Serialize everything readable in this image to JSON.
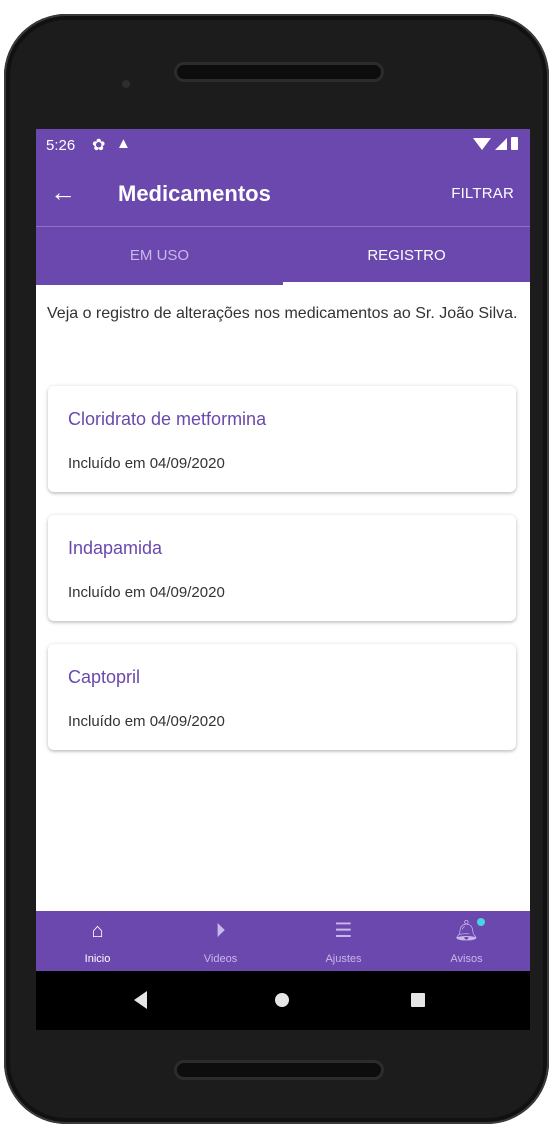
{
  "status_bar": {
    "time": "5:26"
  },
  "app_bar": {
    "back_icon": "arrow-left-icon",
    "title": "Medicamentos",
    "filter_label": "FILTRAR"
  },
  "tabs": [
    {
      "label": "EM USO",
      "active": false
    },
    {
      "label": "REGISTRO",
      "active": true
    }
  ],
  "content": {
    "intro": "Veja o registro de alterações nos medicamentos ao Sr. João Silva.",
    "records": [
      {
        "name": "Cloridrato de metformina",
        "detail": "Incluído em 04/09/2020"
      },
      {
        "name": "Indapamida",
        "detail": "Incluído em 04/09/2020"
      },
      {
        "name": "Captopril",
        "detail": "Incluído em 04/09/2020"
      }
    ]
  },
  "bottom_nav": [
    {
      "label": "Inicio",
      "icon": "home-icon",
      "active": true
    },
    {
      "label": "Videos",
      "icon": "play-circle-icon",
      "active": false
    },
    {
      "label": "Ajustes",
      "icon": "sliders-icon",
      "active": false
    },
    {
      "label": "Avisos",
      "icon": "bell-icon",
      "active": false
    }
  ],
  "colors": {
    "primary": "#6a48ad",
    "accent": "#4dd0e1",
    "inactive": "#c9b8ea"
  }
}
